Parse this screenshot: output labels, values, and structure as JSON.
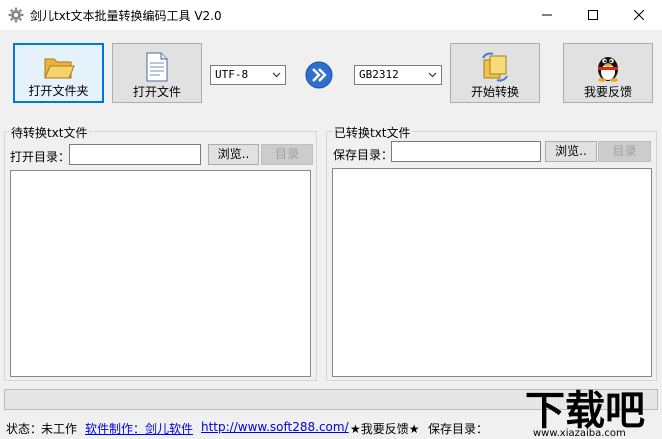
{
  "window": {
    "title": "剑儿txt文本批量转换编码工具 V2.0",
    "minimize_symbol": "—",
    "maximize_symbol": "☐",
    "close_symbol": "✕"
  },
  "toolbar": {
    "open_folder_label": "打开文件夹",
    "open_file_label": "打开文件",
    "source_encoding": "UTF-8",
    "target_encoding": "GB2312",
    "start_label": "开始转换",
    "feedback_label": "我要反馈"
  },
  "left_panel": {
    "group_title": "待转换txt文件",
    "dir_label": "打开目录：",
    "dir_value": "",
    "browse_label": "浏览..",
    "dir_button_label": "目录"
  },
  "right_panel": {
    "group_title": "已转换txt文件",
    "dir_label": "保存目录：",
    "dir_value": "",
    "browse_label": "浏览..",
    "dir_button_label": "目录"
  },
  "status": {
    "state_label": "状态：",
    "state_value": "未工作",
    "author_link": "软件制作：剑儿软件",
    "site_link": "http://www.soft288.com/",
    "feedback_text": "★我要反馈★",
    "save_dir_label": "保存目录："
  },
  "watermark": {
    "main_text": "下载吧",
    "url_text": "www.xiazaiba.com"
  },
  "colors": {
    "accent": "#0078d7",
    "link": "#0000ee"
  }
}
